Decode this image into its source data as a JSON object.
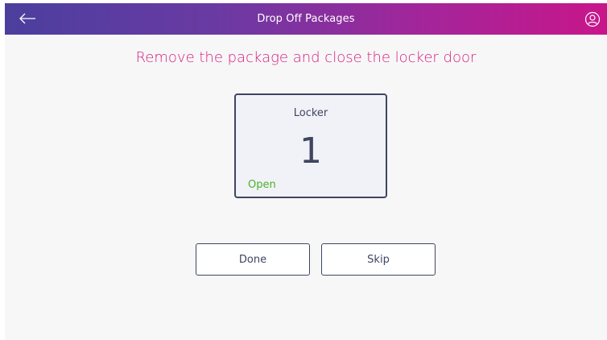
{
  "header": {
    "title": "Drop Off Packages",
    "back_icon": "arrow-left-icon",
    "account_icon": "user-circle-icon"
  },
  "instruction": "Remove the package and close the locker door",
  "locker": {
    "label": "Locker",
    "number": "1",
    "status": "Open"
  },
  "actions": {
    "done_label": "Done",
    "skip_label": "Skip"
  },
  "colors": {
    "header_start": "#4b3f9e",
    "header_end": "#c8168a",
    "accent": "#d61f7f",
    "text": "#3e4660",
    "status_open": "#4caf27",
    "background": "#f7f7f8"
  }
}
